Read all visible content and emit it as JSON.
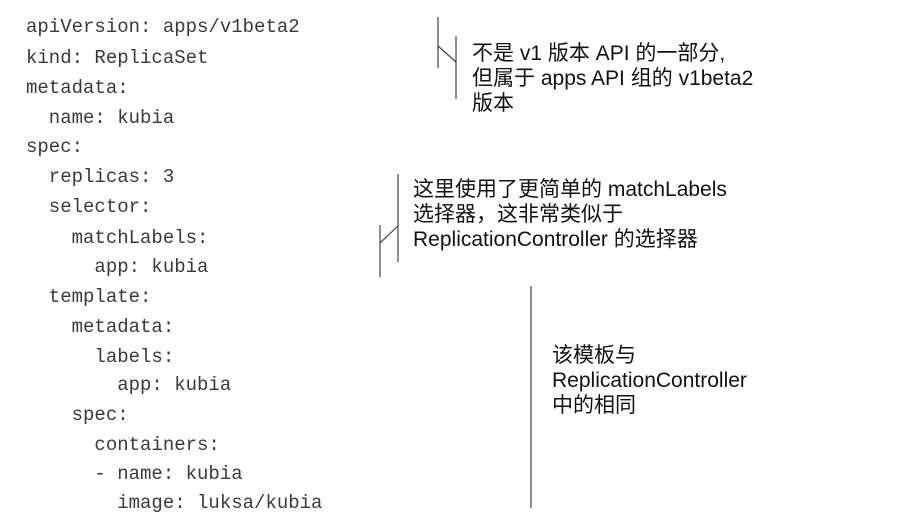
{
  "code_lines": [
    "apiVersion: apps/v1beta2",
    "kind: ReplicaSet",
    "metadata:",
    "  name: kubia",
    "spec:",
    "  replicas: 3",
    "  selector:",
    "    matchLabels:",
    "      app: kubia",
    "  template:",
    "    metadata:",
    "      labels:",
    "        app: kubia",
    "    spec:",
    "      containers:",
    "      - name: kubia",
    "        image: luksa/kubia"
  ],
  "annotations": {
    "api_version": {
      "lines": [
        "不是 v1 版本 API 的一部分,",
        "但属于 apps API 组的 v1beta2",
        "版本"
      ]
    },
    "selector": {
      "lines": [
        "这里使用了更简单的 matchLabels",
        "选择器，这非常类似于",
        "ReplicationController 的选择器"
      ]
    },
    "template": {
      "lines": [
        "该模板与",
        "ReplicationController",
        "中的相同"
      ]
    }
  }
}
